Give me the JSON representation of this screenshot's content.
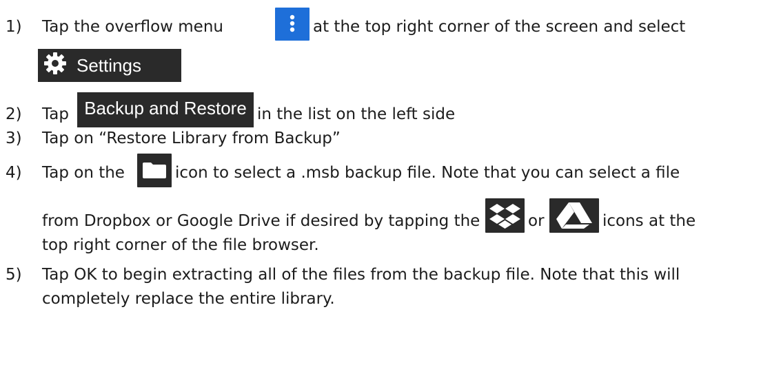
{
  "steps": [
    {
      "num": "1)",
      "a": "Tap the overflow menu",
      "b": "at the top right corner of the screen and select"
    },
    {
      "num": "2)",
      "a": "Tap",
      "b": "in the list on the left side"
    },
    {
      "num": "3)",
      "a": "Tap on “Restore Library from Backup”"
    },
    {
      "num": "4)",
      "a": "Tap on the",
      "b": "icon to select a .msb backup file. Note that you can select a file",
      "c": "from Dropbox or Google Drive if desired by tapping the",
      "d": "or",
      "e": "icons at the",
      "f": "top right corner of the file browser."
    },
    {
      "num": "5)",
      "a": "Tap OK to begin extracting all of the files from the backup file. Note that this will",
      "b": "completely replace the entire library."
    }
  ],
  "ui": {
    "settings_label": "Settings",
    "backup_label": "Backup and Restore"
  },
  "icons": {
    "overflow": "overflow-menu-icon",
    "settings": "gear-icon",
    "folder": "folder-icon",
    "dropbox": "dropbox-icon",
    "drive": "google-drive-icon"
  },
  "colors": {
    "overflow_bg": "#1e6fd9",
    "dark_bg": "#2a2a2a",
    "text": "#1c1c1c"
  }
}
